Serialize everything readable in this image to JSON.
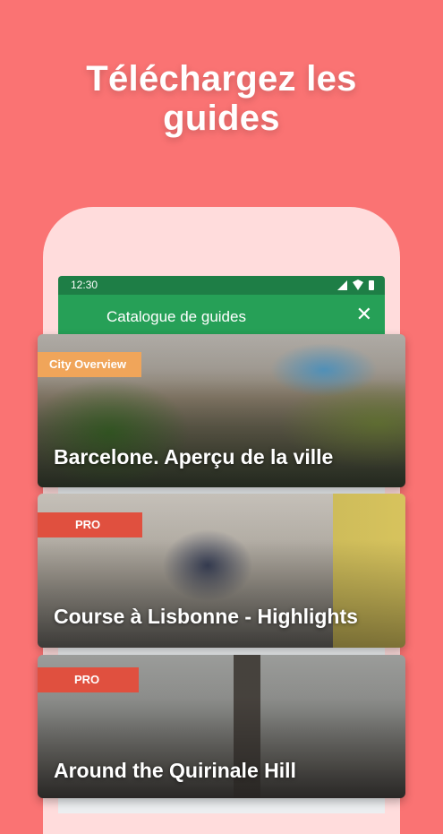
{
  "headline": {
    "line1": "Téléchargez les",
    "line2": "guides"
  },
  "status_bar": {
    "time": "12:30",
    "icons": [
      "signal-icon",
      "wifi-icon",
      "battery-icon"
    ]
  },
  "app_bar": {
    "title": "Catalogue de guides",
    "close_icon": "close-icon"
  },
  "guides": [
    {
      "badge": "City Overview",
      "title": "Barcelone. Aperçu de la ville"
    },
    {
      "badge": "PRO",
      "title": "Course à Lisbonne - Highlights"
    },
    {
      "badge": "PRO",
      "title": "Around the Quirinale Hill"
    }
  ],
  "colors": {
    "background": "#fa7373",
    "phone_frame": "#ffdcdc",
    "status_bar": "#1e7e46",
    "app_bar": "#26a057",
    "badge_city_overview": "#f0a55a",
    "badge_pro": "#e0503f",
    "text": "#ffffff"
  }
}
